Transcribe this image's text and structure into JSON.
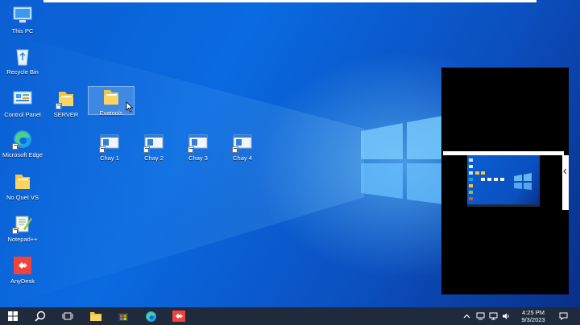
{
  "desktop": {
    "icons": [
      {
        "label": "This PC",
        "icon": "this-pc-icon"
      },
      {
        "label": "Recycle Bin",
        "icon": "recycle-bin-icon"
      },
      {
        "label": "Control Panel",
        "icon": "control-panel-icon"
      },
      {
        "label": "SERVER",
        "icon": "folder-icon"
      },
      {
        "label": "Evatools",
        "icon": "folder-icon"
      },
      {
        "label": "Microsoft Edge",
        "icon": "edge-icon"
      },
      {
        "label": "Chay 1",
        "icon": "window-shortcut-icon"
      },
      {
        "label": "Chay 2",
        "icon": "window-shortcut-icon"
      },
      {
        "label": "Chay 3",
        "icon": "window-shortcut-icon"
      },
      {
        "label": "Chay 4",
        "icon": "window-shortcut-icon"
      },
      {
        "label": "No Quet VS",
        "icon": "folder-icon"
      },
      {
        "label": "Notepad++",
        "icon": "notepad-plus-plus-icon"
      },
      {
        "label": "AnyDesk",
        "icon": "anydesk-icon"
      }
    ]
  },
  "taskbar": {
    "time": "4:25 PM",
    "date": "9/3/2023",
    "pinned": [
      "start-icon",
      "search-icon",
      "task-view-icon",
      "file-explorer-icon",
      "store-icon",
      "edge-icon",
      "anydesk-icon"
    ],
    "tray": [
      "chevron-up-icon",
      "network-icon",
      "monitor-icon",
      "volume-icon",
      "notification-icon"
    ]
  },
  "colors": {
    "taskbar": "#1f2a3c",
    "anydesk": "#ef443b",
    "folder": "#f5c542",
    "accent": "#0b5fd2"
  }
}
